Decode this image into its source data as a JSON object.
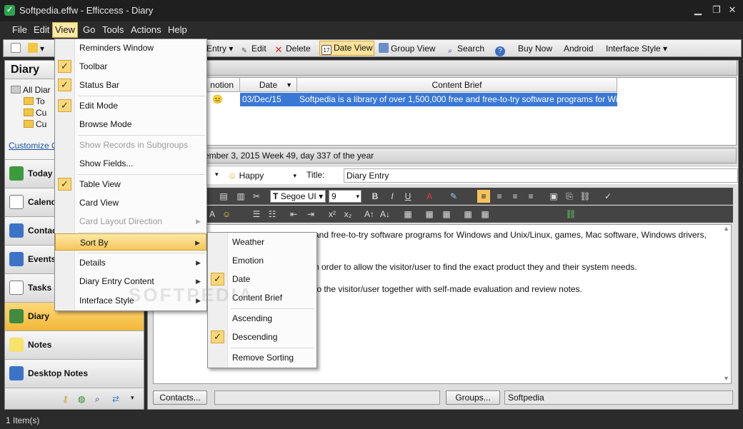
{
  "window": {
    "title": "Softpedia.effw - Efficcess - Diary"
  },
  "menubar": [
    "File",
    "Edit",
    "View",
    "Go",
    "Tools",
    "Actions",
    "Help"
  ],
  "toolbar": {
    "entry_label": "Entry",
    "edit_label": "Edit",
    "delete_label": "Delete",
    "date_view_label": "Date View",
    "group_view_label": "Group View",
    "search_label": "Search",
    "buy_now_label": "Buy Now",
    "android_label": "Android",
    "interface_style_label": "Interface Style"
  },
  "left_panel": {
    "title": "Diary",
    "tree": [
      "All Diar",
      "To",
      "Cu",
      "Cu"
    ],
    "customize_link": "Customize Co",
    "nav": [
      "Today",
      "Calend",
      "Contac",
      "Events",
      "Tasks",
      "Diary",
      "Notes",
      "Desktop Notes"
    ]
  },
  "grid": {
    "columns": [
      "notion",
      "Date",
      "Content Brief"
    ],
    "rows": [
      {
        "emotion": "😐",
        "date": "03/Dec/15",
        "brief": "Softpedia is a library of over 1,500,000 free and free-to-try software programs for Win"
      }
    ]
  },
  "date_bar": {
    "text": "ember 3, 2015   Week 49, day 337 of the year"
  },
  "entry": {
    "emotion": "Happy",
    "title_label": "Title:",
    "title_value": "Diary Entry",
    "font_name": "Segoe UI",
    "font_size": "9",
    "lines": [
      "and free-to-try software programs for Windows and Unix/Linux, games, Mac software, Windows drivers,",
      "n order to allow the visitor/user to find the exact product they and their system needs.",
      "to the visitor/user together with self-made evaluation and review notes."
    ]
  },
  "bottom": {
    "contacts_btn": "Contacts...",
    "groups_btn": "Groups...",
    "groups_value": "Softpedia"
  },
  "status": {
    "items": "1 Item(s)"
  },
  "view_menu": [
    {
      "label": "Reminders Window",
      "checked": false
    },
    {
      "label": "Toolbar",
      "checked": true
    },
    {
      "label": "Status Bar",
      "checked": true
    },
    {
      "label": "Edit Mode",
      "checked": true
    },
    {
      "label": "Browse Mode",
      "checked": false
    },
    {
      "label": "Show Records in Subgroups",
      "checked": false,
      "disabled": true
    },
    {
      "label": "Show Fields...",
      "checked": false
    },
    {
      "label": "Table View",
      "checked": true
    },
    {
      "label": "Card View",
      "checked": false
    },
    {
      "label": "Card Layout Direction",
      "checked": false,
      "disabled": true
    },
    {
      "label": "Sort By",
      "checked": false
    },
    {
      "label": "Details",
      "checked": false
    },
    {
      "label": "Diary Entry Content",
      "checked": false
    },
    {
      "label": "Interface Style",
      "checked": false
    }
  ],
  "sort_menu": [
    {
      "label": "Weather",
      "checked": false
    },
    {
      "label": "Emotion",
      "checked": false
    },
    {
      "label": "Date",
      "checked": true
    },
    {
      "label": "Content Brief",
      "checked": false
    },
    {
      "label": "Ascending",
      "checked": false
    },
    {
      "label": "Descending",
      "checked": true
    },
    {
      "label": "Remove Sorting",
      "checked": false
    }
  ],
  "watermark": "SOFTPEDIA"
}
